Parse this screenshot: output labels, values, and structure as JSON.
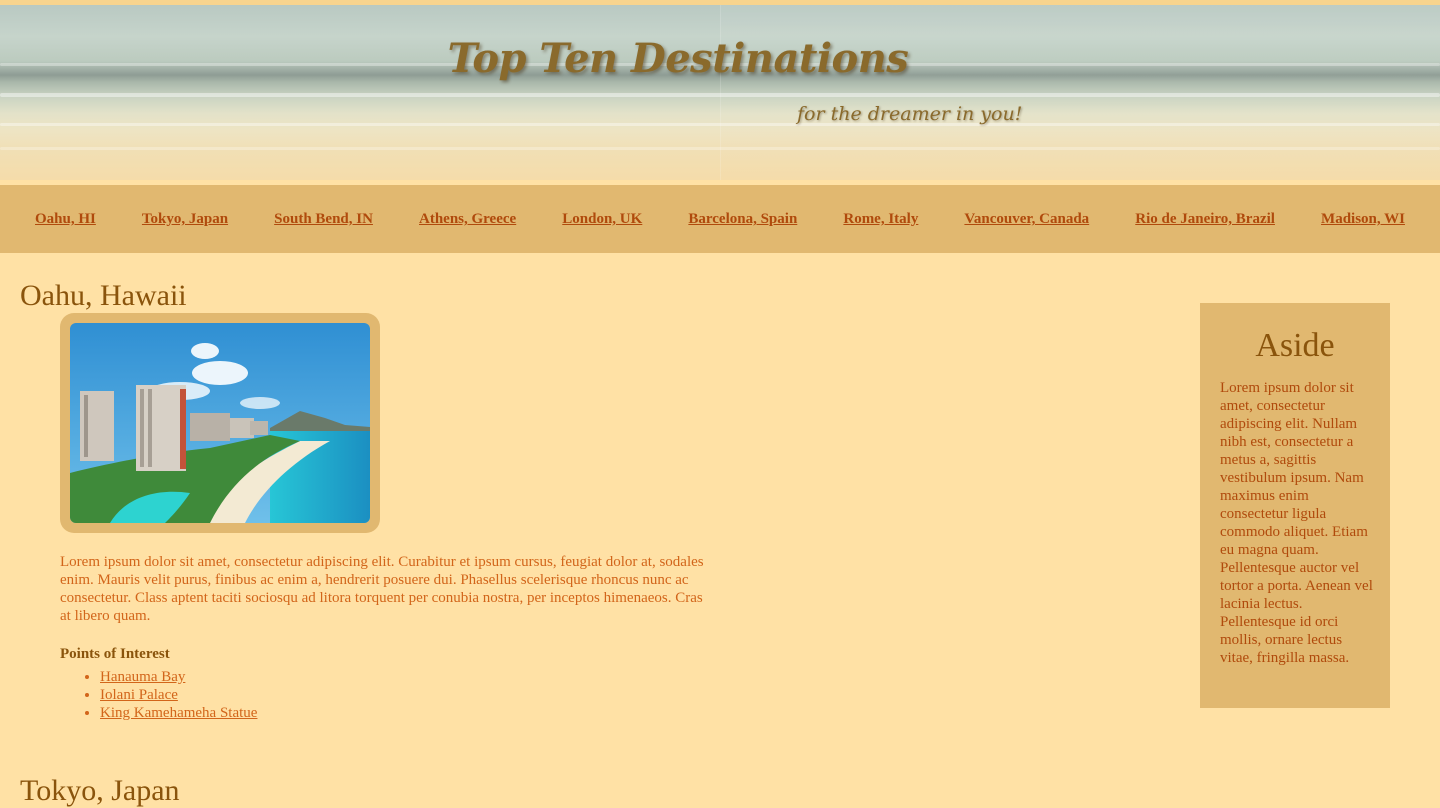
{
  "banner": {
    "title": "Top Ten Destinations",
    "subtitle": "for the dreamer in you!"
  },
  "nav": {
    "items": [
      {
        "label": "Oahu, HI"
      },
      {
        "label": "Tokyo, Japan"
      },
      {
        "label": "South Bend, IN"
      },
      {
        "label": "Athens, Greece"
      },
      {
        "label": "London, UK"
      },
      {
        "label": "Barcelona, Spain"
      },
      {
        "label": "Rome, Italy"
      },
      {
        "label": "Vancouver, Canada"
      },
      {
        "label": "Rio de Janeiro, Brazil"
      },
      {
        "label": "Madison, WI"
      }
    ]
  },
  "sections": [
    {
      "title": "Oahu, Hawaii",
      "image_alt": "Waikiki beach with hotels and Diamond Head",
      "body": "Lorem ipsum dolor sit amet, consectetur adipiscing elit. Curabitur et ipsum cursus, feugiat dolor at, sodales enim. Mauris velit purus, finibus ac enim a, hendrerit posuere dui. Phasellus scelerisque rhoncus nunc ac consectetur. Class aptent taciti sociosqu ad litora torquent per conubia nostra, per inceptos himenaeos. Cras at libero quam.",
      "poi_heading": "Points of Interest",
      "points_of_interest": [
        "Hanauma Bay",
        "Iolani Palace",
        "King Kamehameha Statue"
      ]
    },
    {
      "title": "Tokyo, Japan"
    }
  ],
  "aside": {
    "title": "Aside",
    "body": "Lorem ipsum dolor sit amet, consectetur adipiscing elit. Nullam nibh est, consectetur a metus a, sagittis vestibulum ipsum. Nam maximus enim consectetur ligula commodo aliquet. Etiam eu magna quam. Pellentesque auctor vel tortor a porta. Aenean vel lacinia lectus. Pellentesque id orci mollis, ornare lectus vitae, fringilla massa."
  },
  "colors": {
    "page_background": "#ffe1a5",
    "nav_background": "#e1b870",
    "nav_link": "#b04a0c",
    "heading": "#8a540c",
    "body_text": "#d2651a"
  }
}
